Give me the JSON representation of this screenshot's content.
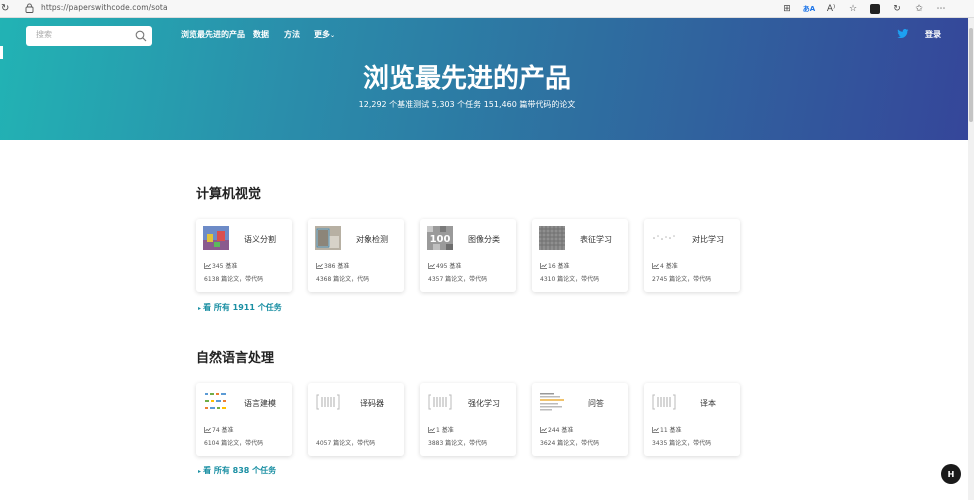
{
  "browser": {
    "url": "https://paperswithcode.com/sota",
    "reload_glyph": "↻"
  },
  "header": {
    "search_placeholder": "搜索",
    "nav": [
      "浏览最先进的产品",
      "数据",
      "方法",
      "更多"
    ],
    "login": "登录",
    "title": "浏览最先进的产品",
    "subtitle": "12,292 个基准测试 5,303 个任务 151,460 篇带代码的论文"
  },
  "sections": [
    {
      "title": "计算机视觉",
      "see_all": "看 所有 1911 个任务",
      "cards": [
        {
          "name": "语义分割",
          "bench": "345 基准",
          "papers": "6138 篇论文，带代码",
          "thumb": "seg-thumbnail-icon"
        },
        {
          "name": "对象检测",
          "bench": "386 基准",
          "papers": "4368 篇论文，代码",
          "thumb": "detection-thumbnail-icon"
        },
        {
          "name": "图像分类",
          "bench": "495 基准",
          "papers": "4357 篇论文，带代码",
          "thumb": "classification-thumbnail-icon",
          "thumb_text": "100"
        },
        {
          "name": "表征学习",
          "bench": "16 基准",
          "papers": "4310 篇论文，带代码",
          "thumb": "representation-thumbnail-icon"
        },
        {
          "name": "对比学习",
          "bench": "4 基准",
          "papers": "2745 篇论文，带代码",
          "thumb": "contrastive-thumbnail-icon"
        }
      ]
    },
    {
      "title": "自然语言处理",
      "see_all": "看 所有 838 个任务",
      "cards": [
        {
          "name": "语言建模",
          "bench": "74 基准",
          "papers": "6104 篇论文，带代码",
          "thumb": "language-model-thumbnail-icon"
        },
        {
          "name": "译码器",
          "bench": "",
          "papers": "4057 篇论文，带代码",
          "thumb": "placeholder-thumbnail-icon"
        },
        {
          "name": "强化学习",
          "bench": "1 基准",
          "papers": "3883 篇论文，带代码",
          "thumb": "placeholder-thumbnail-icon"
        },
        {
          "name": "问答",
          "bench": "244 基准",
          "papers": "3624 篇论文，带代码",
          "thumb": "qa-thumbnail-icon"
        },
        {
          "name": "译本",
          "bench": "11 基准",
          "papers": "3435 篇论文，带代码",
          "thumb": "placeholder-thumbnail-icon"
        }
      ]
    }
  ],
  "help_label": "H",
  "colors": {
    "banner_start": "#22b3b4",
    "banner_end": "#35469a",
    "link": "#1a8fa3"
  }
}
